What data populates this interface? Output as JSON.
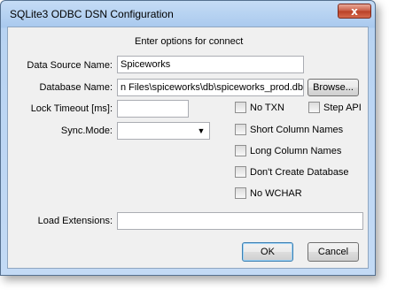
{
  "window": {
    "title": "SQLite3 ODBC DSN Configuration",
    "close_glyph": "x"
  },
  "header": {
    "instruction": "Enter options for connect"
  },
  "fields": {
    "dsn_label": "Data Source Name:",
    "dsn_value": "Spiceworks",
    "db_label": "Database Name:",
    "db_value": "n Files\\spiceworks\\db\\spiceworks_prod.db",
    "browse_label": "Browse...",
    "lock_label": "Lock Timeout [ms]:",
    "lock_value": "",
    "sync_label": "Sync.Mode:",
    "sync_value": "",
    "ext_label": "Load Extensions:",
    "ext_value": ""
  },
  "options": {
    "no_txn": "No TXN",
    "step_api": "Step API",
    "short_cols": "Short Column Names",
    "long_cols": "Long Column Names",
    "dont_create": "Don't Create Database",
    "no_wchar": "No WCHAR"
  },
  "buttons": {
    "ok": "OK",
    "cancel": "Cancel"
  }
}
